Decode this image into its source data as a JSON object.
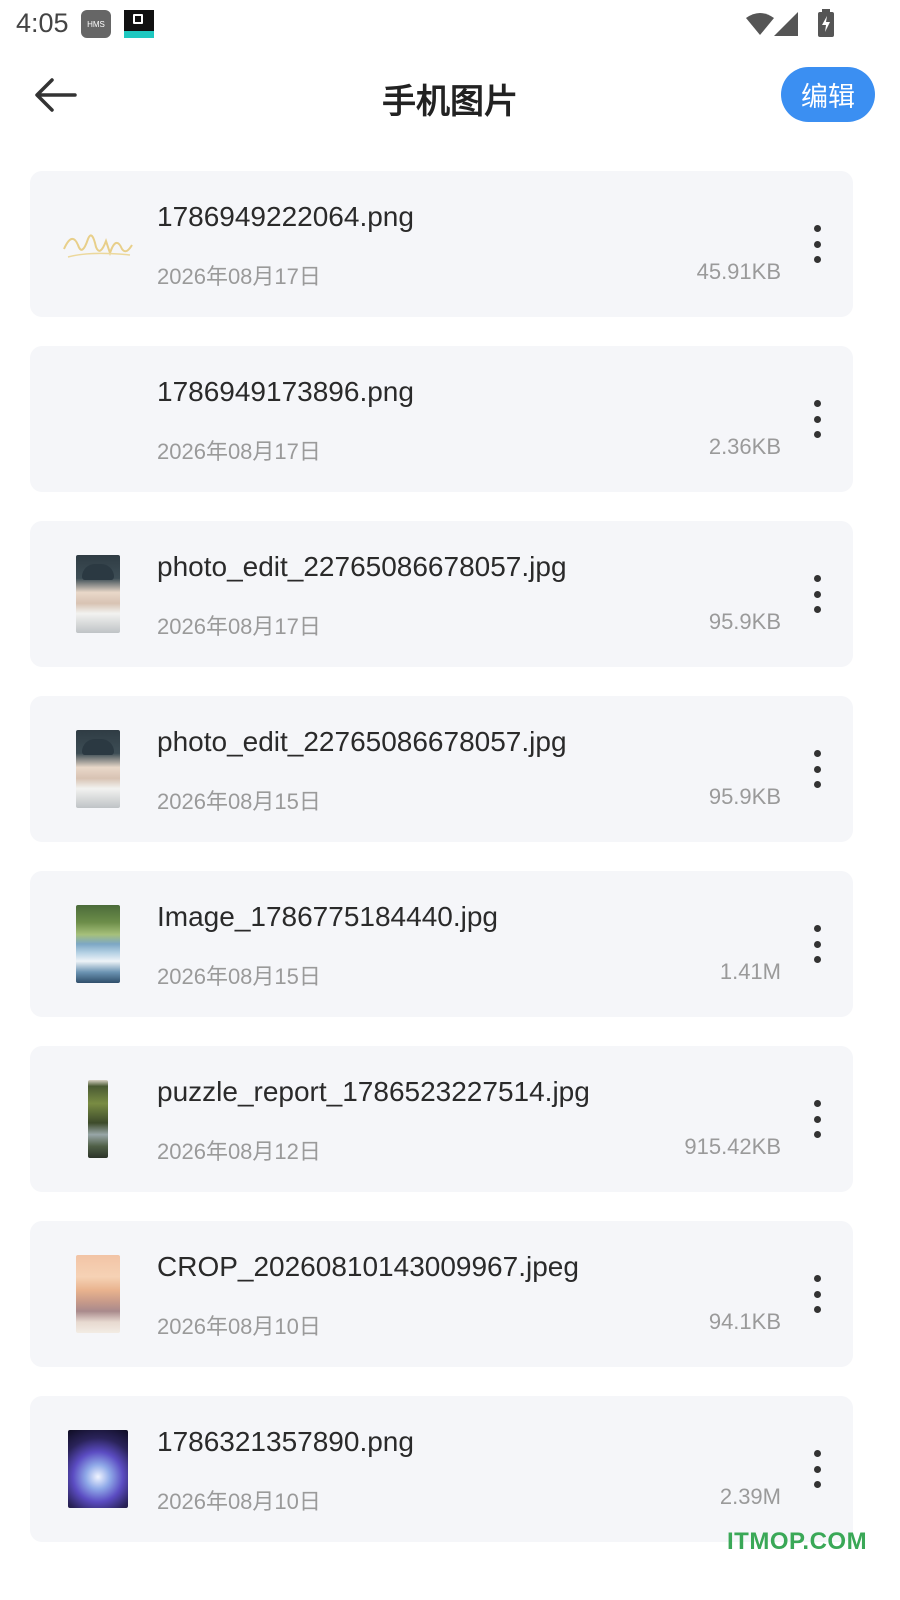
{
  "status_bar": {
    "time": "4:05",
    "hms_badge": "HMS",
    "icons": [
      "wifi-icon",
      "signal-icon",
      "battery-icon"
    ]
  },
  "header": {
    "back_icon": "arrow-left-icon",
    "title": "手机图片",
    "edit_label": "编辑"
  },
  "colors": {
    "accent": "#3b8ff2",
    "card_background": "#f5f6f9",
    "watermark": "#3aa857"
  },
  "files": [
    {
      "name": "1786949222064.png",
      "date": "2026年08月17日",
      "size": "45.91KB",
      "thumbnail": "signature-thumbnail"
    },
    {
      "name": "1786949173896.png",
      "date": "2026年08月17日",
      "size": "2.36KB",
      "thumbnail": "blank-thumbnail"
    },
    {
      "name": "photo_edit_22765086678057.jpg",
      "date": "2026年08月17日",
      "size": "95.9KB",
      "thumbnail": "portrait-thumbnail"
    },
    {
      "name": "photo_edit_22765086678057.jpg",
      "date": "2026年08月15日",
      "size": "95.9KB",
      "thumbnail": "portrait-thumbnail"
    },
    {
      "name": "Image_1786775184440.jpg",
      "date": "2026年08月15日",
      "size": "1.41M",
      "thumbnail": "landscape-thumbnail"
    },
    {
      "name": "puzzle_report_1786523227514.jpg",
      "date": "2026年08月12日",
      "size": "915.42KB",
      "thumbnail": "puzzle-thumbnail"
    },
    {
      "name": "CROP_20260810143009967.jpeg",
      "date": "2026年08月10日",
      "size": "94.1KB",
      "thumbnail": "sunset-thumbnail"
    },
    {
      "name": "1786321357890.png",
      "date": "2026年08月10日",
      "size": "2.39M",
      "thumbnail": "anime-thumbnail"
    }
  ],
  "more_icon": "more-vertical-icon",
  "watermark": "ITMOP.COM"
}
